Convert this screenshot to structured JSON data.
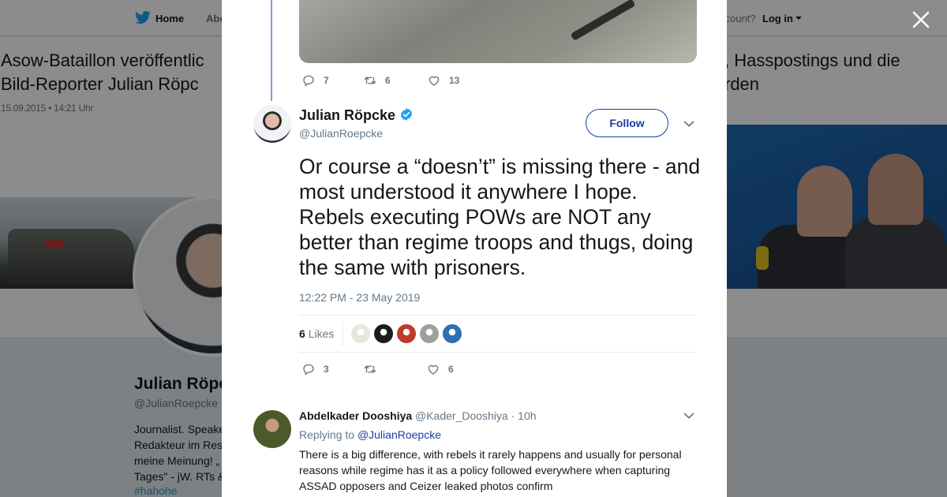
{
  "background_page": {
    "nav": {
      "home_label": "Home",
      "second_item_partial": "Abe",
      "account_prompt_partial": "ccount?",
      "login_label": "Log in"
    },
    "article": {
      "headline_left": "Asow-Bataillon veröffentlic Bild-Reporter Julian Röpc",
      "headline_right_line1": ", Hasspostings und die",
      "headline_right_line2": "rden",
      "date": "15.09.2015 • 14:21 Uhr"
    },
    "profile": {
      "name_partial": "Julian Röpc",
      "handle": "@JulianRoepcke",
      "bio_lines": [
        "Journalist. Speake",
        "Redakteur im Res",
        "meine Meinung! „",
        "Tages\" - jW. RTs &"
      ],
      "hashtag": "#hahohe"
    }
  },
  "modal": {
    "prev_tweet_actions": {
      "replies": "7",
      "retweets": "6",
      "likes": "13"
    },
    "tweet": {
      "author_name": "Julian Röpcke",
      "author_handle": "@JulianRoepcke",
      "verified": true,
      "follow_label": "Follow",
      "text": "Or course a “doesn’t” is missing there - and most understood it anywhere I hope. Rebels executing POWs are NOT any better than regime troops and thugs, doing the same with prisoners.",
      "timestamp": "12:22 PM - 23 May 2019",
      "likes_count": "6",
      "likes_label": "Likes",
      "liker_colors": [
        "#e9e6e0",
        "#1c1c1c",
        "#c0392b",
        "#9aa39a",
        "#2f6fb3"
      ],
      "actions": {
        "replies": "3",
        "retweets": "",
        "likes": "6"
      }
    },
    "reply": {
      "author_name": "Abdelkader Dooshiya",
      "meta": "@Kader_Dooshiya · 10h",
      "replying_prefix": "Replying to",
      "replying_to": "@JulianRoepcke",
      "text": "There is a big difference, with rebels it rarely happens and usually for personal reasons while regime has it as a policy followed everywhere when capturing ASSAD opposers and Ceizer leaked photos confirm"
    }
  },
  "colors": {
    "twitter_blue": "#1da1f2",
    "link_blue": "#1d3ca0",
    "thread_line": "#9c8ed9",
    "secondary_text": "#657786"
  }
}
